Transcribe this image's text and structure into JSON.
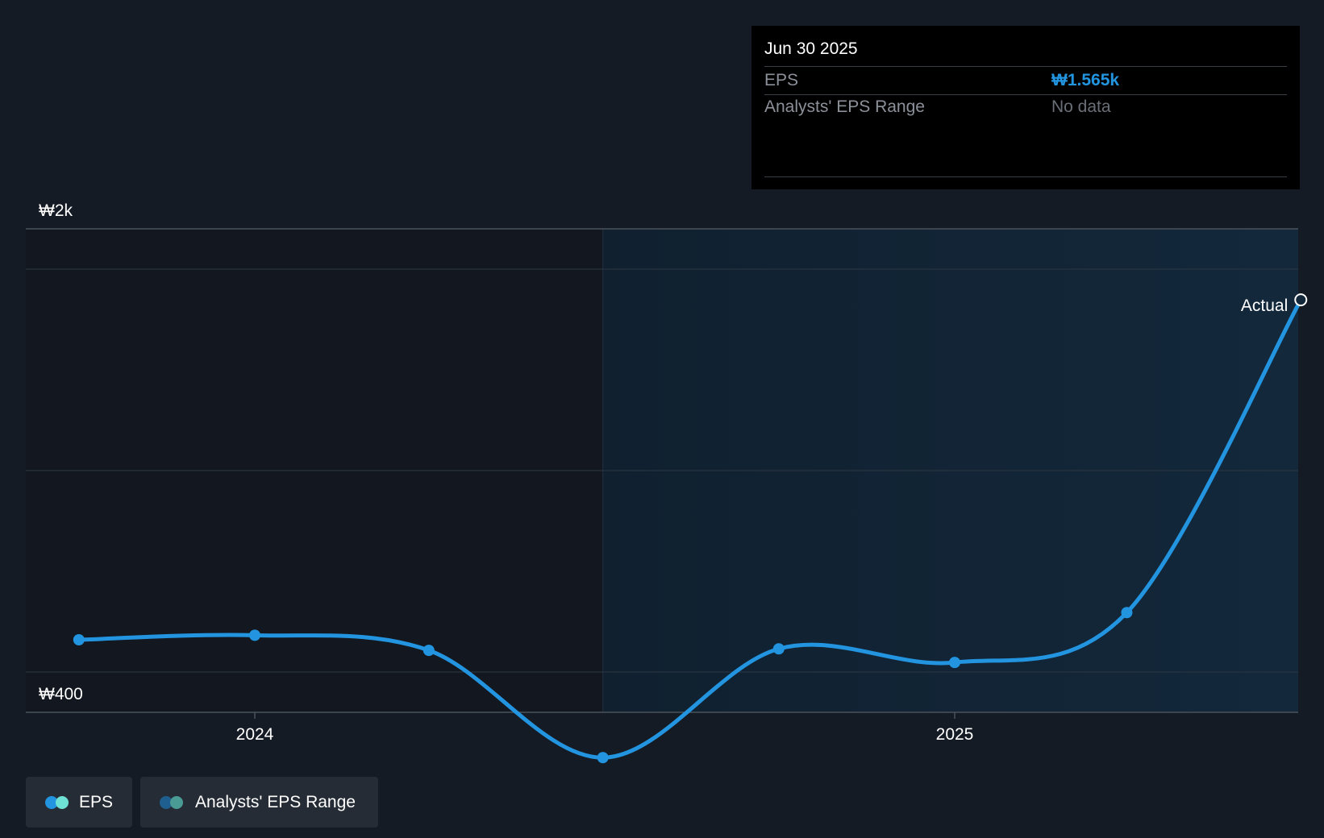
{
  "chart_data": {
    "type": "line",
    "currency_symbol": "₩",
    "y_axis": {
      "top_label": "₩2k",
      "bottom_label": "₩400",
      "ylim": [
        400,
        2000
      ]
    },
    "x_axis": {
      "ticks": [
        {
          "label": "2024",
          "date": "2023-12-31"
        },
        {
          "label": "2025",
          "date": "2024-12-31"
        }
      ]
    },
    "series": [
      {
        "name": "EPS",
        "color": "#2394df",
        "points": [
          {
            "date": "2023-09-30",
            "value": 640
          },
          {
            "date": "2023-12-31",
            "value": 655
          },
          {
            "date": "2024-03-31",
            "value": 605
          },
          {
            "date": "2024-06-30",
            "value": 250
          },
          {
            "date": "2024-09-30",
            "value": 610
          },
          {
            "date": "2024-12-31",
            "value": 565
          },
          {
            "date": "2025-03-31",
            "value": 730
          },
          {
            "date": "2025-06-30",
            "value": 1765
          }
        ]
      }
    ],
    "forecast_start_date": "2024-06-30",
    "end_label": "Actual",
    "colors": {
      "background": "#151b24",
      "past_region": "#131820",
      "future_region": "#13283b",
      "line": "#2394df",
      "grid": "#2e3742"
    }
  },
  "tooltip": {
    "date": "Jun 30 2025",
    "rows": [
      {
        "label": "EPS",
        "value": "₩1.565k"
      },
      {
        "label": "Analysts' EPS Range",
        "value": "No data"
      }
    ]
  },
  "legend": [
    {
      "label": "EPS",
      "colors": [
        "#2394df",
        "#6fe0d4"
      ]
    },
    {
      "label": "Analysts' EPS Range",
      "colors": [
        "#1f5f8f",
        "#4a9b96"
      ]
    }
  ]
}
